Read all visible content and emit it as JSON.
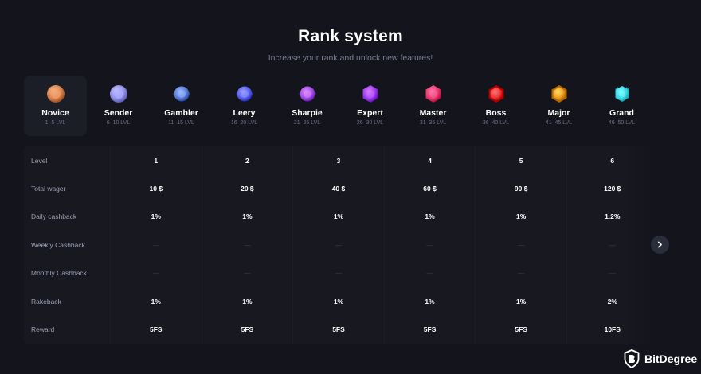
{
  "header": {
    "title": "Rank system",
    "subtitle": "Increase your rank and unlock new features!"
  },
  "ranks": [
    {
      "name": "Novice",
      "levels": "1–5 LVL",
      "color": "#d4824f",
      "icon": "novice-badge-icon"
    },
    {
      "name": "Sender",
      "levels": "6–10 LVL",
      "color": "#8f8fe8",
      "icon": "sender-badge-icon"
    },
    {
      "name": "Gambler",
      "levels": "11–15 LVL",
      "color": "#5d7ed8",
      "icon": "gambler-badge-icon"
    },
    {
      "name": "Leery",
      "levels": "16–20 LVL",
      "color": "#5a62ee",
      "icon": "leery-badge-icon"
    },
    {
      "name": "Sharpie",
      "levels": "21–25 LVL",
      "color": "#a24fe6",
      "icon": "sharpie-badge-icon"
    },
    {
      "name": "Expert",
      "levels": "26–30 LVL",
      "color": "#9b3ef0",
      "icon": "expert-badge-icon"
    },
    {
      "name": "Master",
      "levels": "31–35 LVL",
      "color": "#e83a6e",
      "icon": "master-badge-icon"
    },
    {
      "name": "Boss",
      "levels": "36–40 LVL",
      "color": "#ee3a3a",
      "icon": "boss-badge-icon"
    },
    {
      "name": "Major",
      "levels": "41–45 LVL",
      "color": "#f0a326",
      "icon": "major-badge-icon"
    },
    {
      "name": "Grand",
      "levels": "46–50 LVL",
      "color": "#3fd6e6",
      "icon": "grand-badge-icon"
    }
  ],
  "table": {
    "rows": [
      {
        "label": "Level",
        "cells": [
          "1",
          "2",
          "3",
          "4",
          "5",
          "6"
        ]
      },
      {
        "label": "Total wager",
        "cells": [
          "10 $",
          "20 $",
          "40 $",
          "60 $",
          "90 $",
          "120 $"
        ]
      },
      {
        "label": "Daily cashback",
        "cells": [
          "1%",
          "1%",
          "1%",
          "1%",
          "1%",
          "1.2%"
        ]
      },
      {
        "label": "Weekly Cashback",
        "cells": [
          "—",
          "—",
          "—",
          "—",
          "—",
          "—"
        ]
      },
      {
        "label": "Monthly Cashback",
        "cells": [
          "—",
          "—",
          "—",
          "—",
          "—",
          "—"
        ]
      },
      {
        "label": "Rakeback",
        "cells": [
          "1%",
          "1%",
          "1%",
          "1%",
          "1%",
          "2%"
        ]
      },
      {
        "label": "Reward",
        "cells": [
          "5FS",
          "5FS",
          "5FS",
          "5FS",
          "5FS",
          "10FS"
        ]
      }
    ]
  },
  "navigation": {
    "next_icon": "chevron-right-icon"
  },
  "watermark": {
    "text": "BitDegree",
    "icon": "bitdegree-shield-icon"
  },
  "colors": {
    "background": "#13141c",
    "panel": "#171820",
    "active_rank": "#1b1d27",
    "muted_text": "#7b7f93"
  }
}
